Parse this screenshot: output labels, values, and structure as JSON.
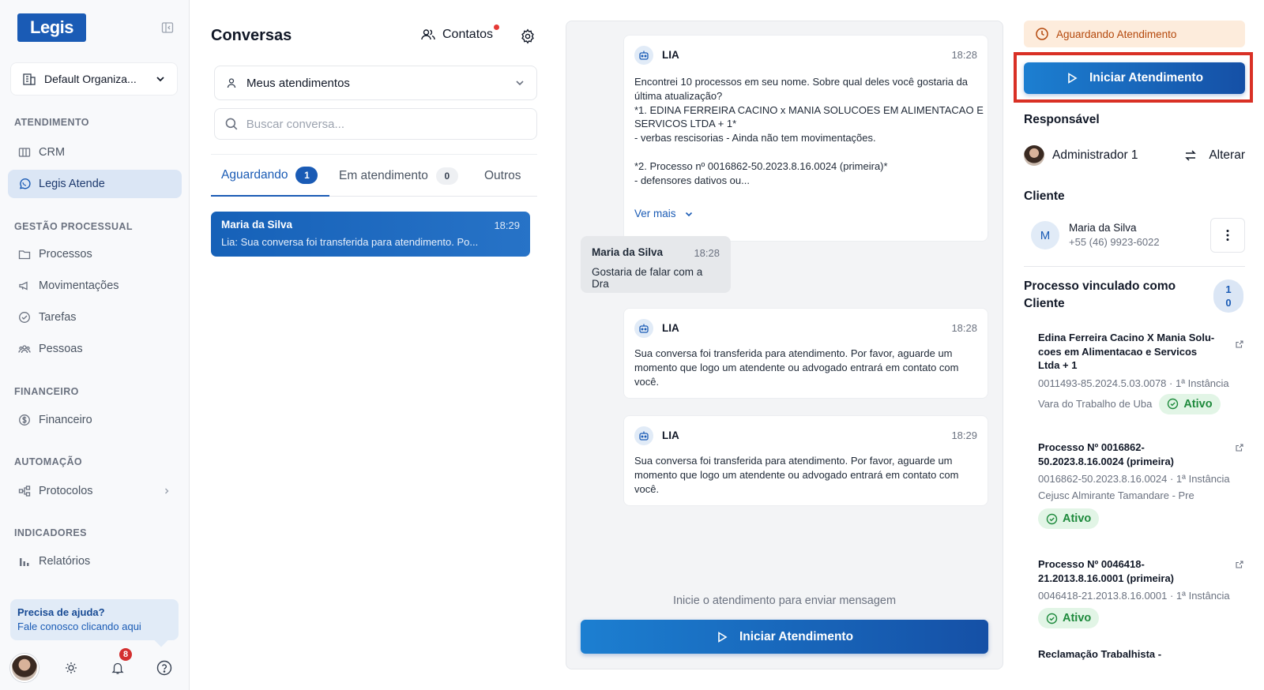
{
  "sidebar": {
    "logo": "Legis",
    "org": "Default Organiza...",
    "sections": [
      {
        "label": "ATENDIMENTO"
      },
      {
        "label": "GESTÃO PROCESSUAL"
      },
      {
        "label": "FINANCEIRO"
      },
      {
        "label": "AUTOMAÇÃO"
      },
      {
        "label": "INDICADORES"
      }
    ],
    "items": [
      {
        "label": "CRM",
        "icon": "kanban-icon"
      },
      {
        "label": "Legis Atende",
        "icon": "whatsapp-icon"
      },
      {
        "label": "Processos",
        "icon": "folder-icon"
      },
      {
        "label": "Movimentações",
        "icon": "megaphone-icon"
      },
      {
        "label": "Tarefas",
        "icon": "check-circle-icon"
      },
      {
        "label": "Pessoas",
        "icon": "people-icon"
      },
      {
        "label": "Financeiro",
        "icon": "dollar-icon"
      },
      {
        "label": "Protocolos",
        "icon": "workflow-icon"
      },
      {
        "label": "Relatórios",
        "icon": "bar-chart-icon"
      }
    ],
    "help": {
      "title": "Precisa de ajuda?",
      "link": "Fale conosco clicando aqui"
    },
    "notifications_count": "8"
  },
  "conversations": {
    "title": "Conversas",
    "contacts_label": "Contatos",
    "filter_value": "Meus atendimentos",
    "search_placeholder": "Buscar conversa...",
    "tabs": [
      {
        "label": "Aguardando",
        "count": "1"
      },
      {
        "label": "Em atendimento",
        "count": "0"
      },
      {
        "label": "Outros"
      }
    ],
    "items": [
      {
        "name": "Maria da Silva",
        "time": "18:29",
        "preview": "Lia: Sua conversa foi transferida para atendimento. Po..."
      }
    ]
  },
  "chat": {
    "messages": [
      {
        "sender": "LIA",
        "time": "18:28",
        "lines": [
          "Encontrei 10 processos em seu nome. Sobre qual deles você gostaria da",
          "última atualização?",
          "*1. EDINA FERREIRA CACINO x MANIA SOLUCOES EM ALIMENTACAO E",
          "SERVICOS LTDA + 1*",
          "- verbas rescisorias  - Ainda não tem movimentações.",
          "",
          "*2. Processo nº 0016862-50.2023.8.16.0024 (primeira)*",
          "- defensores dativos ou..."
        ],
        "more_label": "Ver mais"
      },
      {
        "sender": "Maria da Silva",
        "time": "18:28",
        "text": "Gostaria de falar com a Dra"
      },
      {
        "sender": "LIA",
        "time": "18:28",
        "lines": [
          "Sua conversa foi transferida para atendimento. Por favor, aguarde um",
          "momento que logo um atendente ou advogado entrará em contato com",
          "você."
        ]
      },
      {
        "sender": "LIA",
        "time": "18:29",
        "lines": [
          "Sua conversa foi transferida para atendimento. Por favor, aguarde um",
          "momento que logo um atendente ou advogado entrará em contato com",
          "você."
        ]
      }
    ],
    "hint": "Inicie o atendimento para enviar mensagem",
    "start_button": "Iniciar Atendimento"
  },
  "details": {
    "status_banner": "Aguardando Atendimento",
    "start_button": "Iniciar Atendimento",
    "responsible_label": "Responsável",
    "responsible_name": "Administrador 1",
    "change_label": "Alterar",
    "client_label": "Cliente",
    "client": {
      "initial": "M",
      "name": "Maria da Silva",
      "phone": "+55 (46) 9923-6022"
    },
    "processes_title": "Processo vinculado como Cliente",
    "processes_count_line1": "1",
    "processes_count_line2": "0",
    "processes": [
      {
        "name_lines": [
          "Edina Ferreira Cacino X Mania Solu-",
          "coes em Alimentacao e Servicos",
          "Ltda + 1"
        ],
        "number": "0011493-85.2024.5.03.0078 · 1ª Instância",
        "court": "Vara do Trabalho de Uba",
        "status": "Ativo"
      },
      {
        "name_lines": [
          "Processo Nº 0016862-",
          "50.2023.8.16.0024 (primeira)"
        ],
        "number": "0016862-50.2023.8.16.0024 · 1ª Instância",
        "court": "Cejusc Almirante Tamandare - Pre",
        "status": "Ativo"
      },
      {
        "name_lines": [
          "Processo Nº 0046418-",
          "21.2013.8.16.0001 (primeira)"
        ],
        "number": "0046418-21.2013.8.16.0001 · 1ª Instância",
        "status": "Ativo"
      },
      {
        "name_lines": [
          "Reclamação Trabalhista -"
        ]
      }
    ]
  },
  "colors": {
    "brand": "#1a5bb5",
    "active_green": "#1e8a3c",
    "warning": "#b4480c",
    "highlight": "#d93025"
  }
}
